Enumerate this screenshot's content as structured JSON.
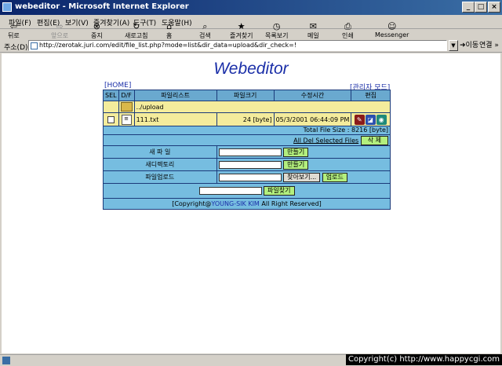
{
  "window": {
    "title": "webeditor - Microsoft Internet Explorer"
  },
  "menu": [
    "파일(F)",
    "편집(E)",
    "보기(V)",
    "즐겨찾기(A)",
    "도구(T)",
    "도움말(H)"
  ],
  "toolbar": [
    {
      "label": "뒤로",
      "icon": "back-arrow-icon",
      "glyph": "⇦"
    },
    {
      "label": "앞으로",
      "icon": "forward-arrow-icon",
      "glyph": "⇨"
    },
    {
      "label": "중지",
      "icon": "stop-icon",
      "glyph": "⊗"
    },
    {
      "label": "새로고침",
      "icon": "refresh-icon",
      "glyph": "↻"
    },
    {
      "label": "홈",
      "icon": "home-icon",
      "glyph": "⌂"
    },
    {
      "label": "검색",
      "icon": "search-icon",
      "glyph": "⌕"
    },
    {
      "label": "즐겨찾기",
      "icon": "favorites-icon",
      "glyph": "★"
    },
    {
      "label": "목록보기",
      "icon": "history-icon",
      "glyph": "◷"
    },
    {
      "label": "메일",
      "icon": "mail-icon",
      "glyph": "✉"
    },
    {
      "label": "인쇄",
      "icon": "print-icon",
      "glyph": "⎙"
    },
    {
      "label": "Messenger",
      "icon": "messenger-icon",
      "glyph": "☺"
    }
  ],
  "address": {
    "label": "주소(D)",
    "url": "http://zerotak.juri.com/edit/file_list.php?mode=list&dir_data=upload&dir_check=!",
    "go": "이동",
    "links": "연결 »"
  },
  "page": {
    "title": "Webeditor",
    "home_link": "[HOME]",
    "admin_link": "[관리자 모드]",
    "headers": [
      "SEL",
      "D/F",
      "파일리스트",
      "파일크기",
      "수정시간",
      "편집"
    ],
    "folder_row": {
      "name": "../upload"
    },
    "file_row": {
      "name": "111.txt",
      "size": "24 [byte]",
      "modified": "05/3/2001 06:44:09 PM"
    },
    "total_size": "Total File Size : 8216 [byte]",
    "all_del_label": "All Del Selected Files",
    "delete_btn": "삭      제",
    "new_file_label": "새   파   일",
    "new_file_btn": "만들기",
    "new_dir_label": "새디렉토리",
    "new_dir_btn": "만들기",
    "upload_label": "파일업로드",
    "browse_btn": "찾아보기...",
    "upload_btn": "업로드",
    "search_btn": "파일찾기",
    "copyright_pre": "[Copyright@",
    "copyright_name": "YOUNG-SIK KIM",
    "copyright_post": " All Right Reserved]"
  },
  "overlay": {
    "copyright": "Copyright(c) http://www.happycgi.com"
  },
  "colors": {
    "header_bg": "#6aa9cf",
    "row_bg": "#f4ec9c",
    "panel_bg": "#76bde0",
    "button_green": "#b3ef7e",
    "title_blue": "#1b2fa8"
  }
}
